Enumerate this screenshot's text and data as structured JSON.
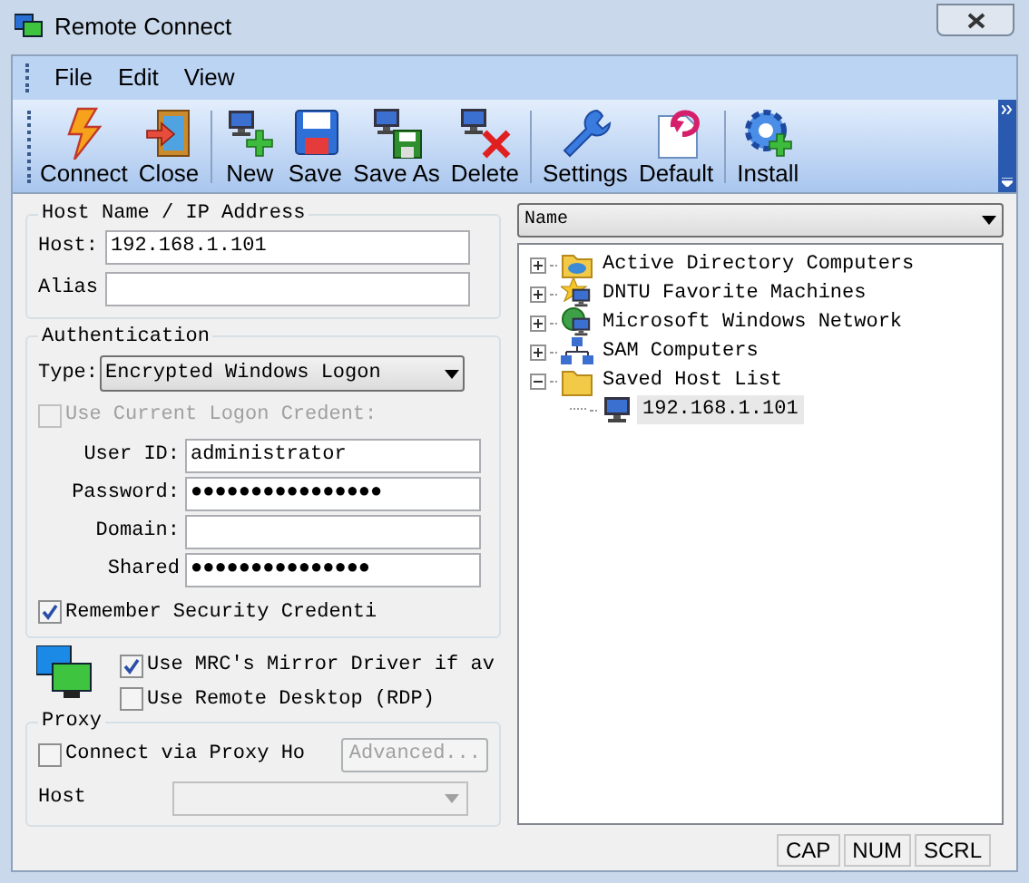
{
  "window": {
    "title": "Remote Connect"
  },
  "menu": [
    "File",
    "Edit",
    "View"
  ],
  "toolbar": [
    {
      "label": "Connect",
      "kind": "connect"
    },
    {
      "label": "Close",
      "kind": "close",
      "sep_after": true
    },
    {
      "label": "New",
      "kind": "new"
    },
    {
      "label": "Save",
      "kind": "save"
    },
    {
      "label": "Save As",
      "kind": "saveas"
    },
    {
      "label": "Delete",
      "kind": "delete",
      "sep_after": true
    },
    {
      "label": "Settings",
      "kind": "settings"
    },
    {
      "label": "Default",
      "kind": "default",
      "sep_after": true
    },
    {
      "label": "Install",
      "kind": "install"
    }
  ],
  "host_group": {
    "title": "Host Name / IP Address",
    "fields": [
      {
        "label": "Host:",
        "value": "192.168.1.101"
      },
      {
        "label": "Alias"
      }
    ]
  },
  "authentication": {
    "title": "Authentication",
    "type_label": "Type:",
    "type_value": "Encrypted Windows Logon",
    "use_current": {
      "label": "Use Current Logon Credent:",
      "checked": false,
      "disabled": true
    },
    "fields": [
      {
        "label": "User ID:",
        "value": "administrator"
      },
      {
        "label": "Password:",
        "value": "●●●●●●●●●●●●●●●●"
      },
      {
        "label": "Domain:"
      },
      {
        "label": "Shared",
        "value": "●●●●●●●●●●●●●●●"
      }
    ],
    "remember": {
      "label": "Remember Security Credenti",
      "checked": true
    }
  },
  "options": [
    {
      "label": "Use MRC's Mirror Driver if av",
      "checked": true
    },
    {
      "label": "Use Remote Desktop (RDP)",
      "checked": false
    }
  ],
  "proxy": {
    "title": "Proxy",
    "checkbox": {
      "label": "Connect via Proxy Ho",
      "checked": false
    },
    "advanced": {
      "label": "Advanced...",
      "disabled": true
    },
    "host_label": "Host",
    "host_disabled": true
  },
  "column_select": "Name",
  "tree": [
    {
      "label": "Active Directory Computers",
      "kind": "folder-globe",
      "expanded": false
    },
    {
      "label": "DNTU Favorite Machines",
      "kind": "star",
      "expanded": false
    },
    {
      "label": "Microsoft Windows Network",
      "kind": "globe",
      "expanded": false
    },
    {
      "label": "SAM Computers",
      "kind": "network",
      "expanded": false
    },
    {
      "label": "Saved Host List",
      "kind": "folder",
      "expanded": true,
      "children": [
        {
          "label": "192.168.1.101",
          "kind": "monitor",
          "selected": true
        }
      ]
    }
  ],
  "status_bar": [
    "CAP",
    "NUM",
    "SCRL"
  ]
}
